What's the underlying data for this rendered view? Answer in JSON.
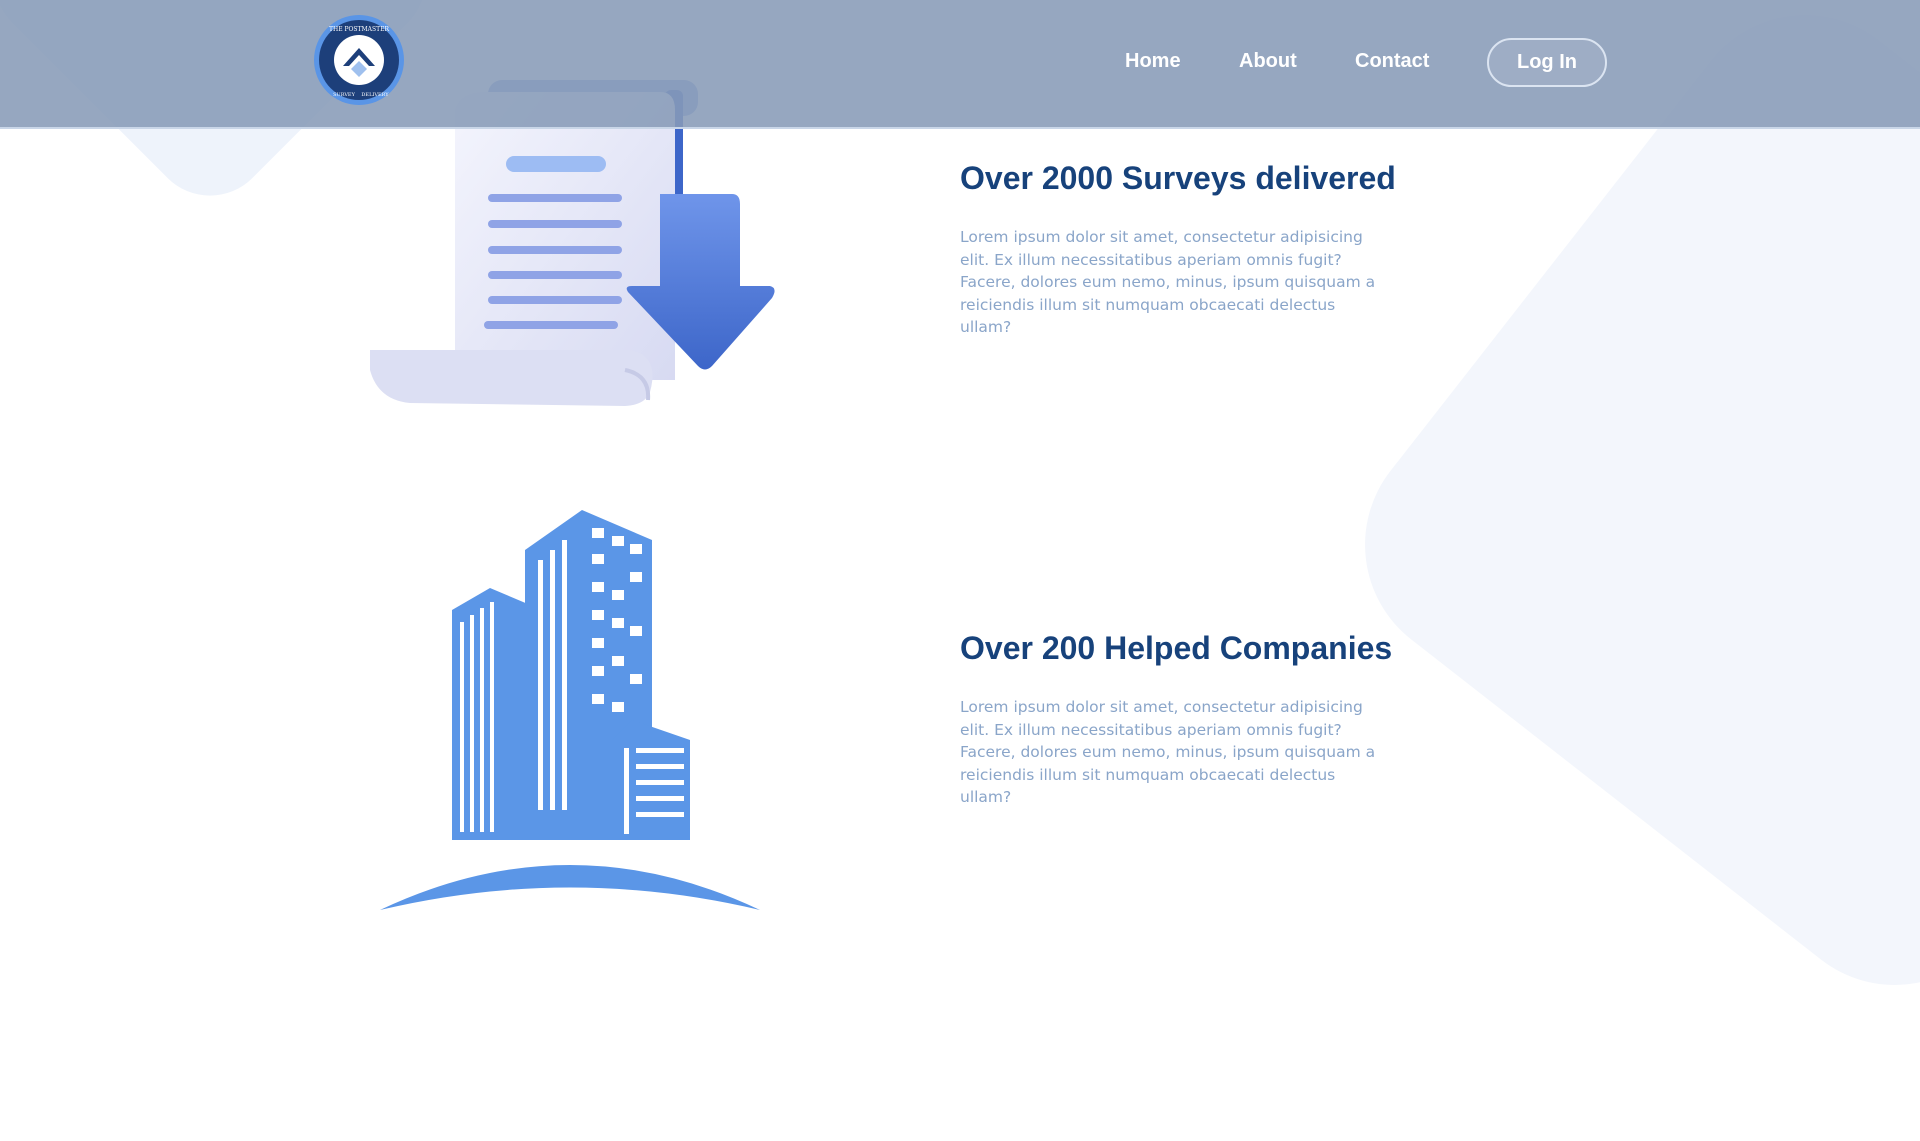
{
  "header": {
    "logo": {
      "top_text": "THE POSTMASTER",
      "bottom_left": "SURVEY",
      "bottom_right": "DELIVERY",
      "icon": "chevron-up-icon"
    },
    "nav": [
      {
        "label": "Home"
      },
      {
        "label": "About"
      },
      {
        "label": "Contact"
      }
    ],
    "login_label": "Log In"
  },
  "stats": [
    {
      "title": "Over 2000 Surveys delivered",
      "body": "Lorem ipsum dolor sit amet, consectetur adipisicing elit. Ex illum necessitatibus aperiam omnis fugit? Facere, dolores eum nemo, minus, ipsum quisquam a reiciendis illum sit numquam obcaecati delectus ullam?",
      "icon": "document-download-icon"
    },
    {
      "title": "Over 200 Helped Companies",
      "body": "Lorem ipsum dolor sit amet, consectetur adipisicing elit. Ex illum necessitatibus aperiam omnis fugit? Facere, dolores eum nemo, minus, ipsum quisquam a reiciendis illum sit numquam obcaecati delectus ullam?",
      "icon": "office-buildings-icon"
    }
  ],
  "colors": {
    "header_bg": "#879bb7",
    "title": "#17427b",
    "body_text": "#8aa5c9",
    "accent": "#5a95e6"
  }
}
